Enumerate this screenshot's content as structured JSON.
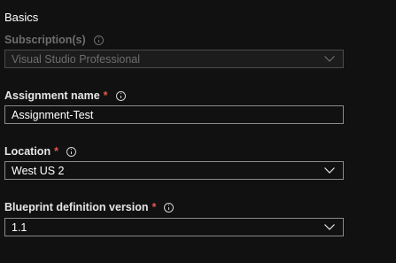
{
  "section": {
    "title": "Basics"
  },
  "subscription": {
    "label": "Subscription(s)",
    "value": "Visual Studio Professional",
    "disabled": true
  },
  "assignment_name": {
    "label": "Assignment name",
    "required_mark": "*",
    "value": "Assignment-Test"
  },
  "location": {
    "label": "Location",
    "required_mark": "*",
    "value": "West US 2"
  },
  "blueprint_version": {
    "label": "Blueprint definition version",
    "required_mark": "*",
    "value": "1.1"
  },
  "icons": {
    "info": "info-icon",
    "dropdown": "chevron-down-icon"
  },
  "colors": {
    "background": "#111111",
    "required": "#e0574f",
    "border": "#8a8a8a",
    "disabled_text": "#6e6e6e"
  }
}
